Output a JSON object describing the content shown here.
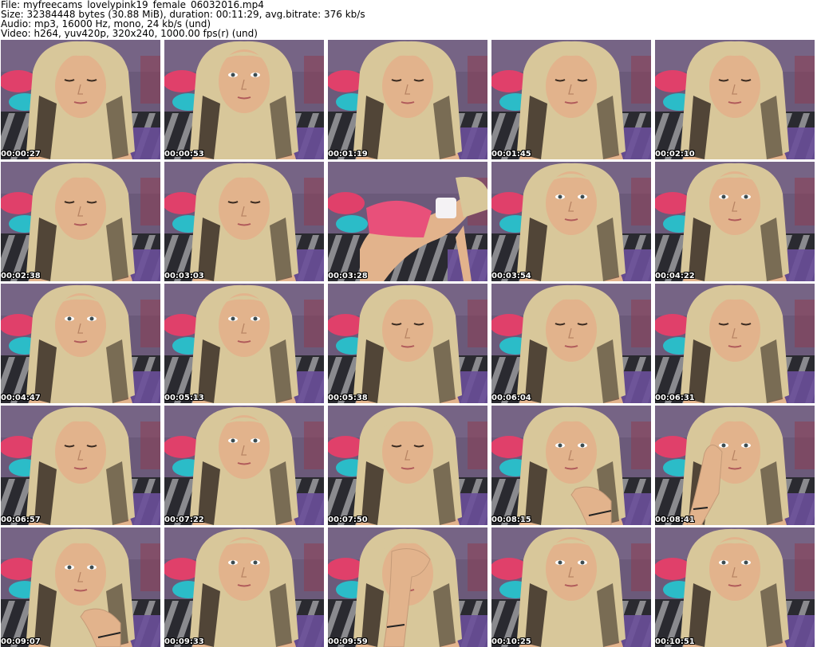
{
  "header": {
    "file_line": "File: myfreecams_lovelypink19_female_06032016.mp4",
    "size_line": "Size: 32384448 bytes (30.88 MiB), duration: 00:11:29, avg.bitrate: 376 kb/s",
    "audio_line": "Audio: mp3, 16000 Hz, mono, 24 kb/s (und)",
    "video_line": "Video: h264, yuv420p, 320x240, 1000.00 fps(r) (und)"
  },
  "thumbnails": [
    {
      "timestamp": "00:00:27",
      "pose": "face-down"
    },
    {
      "timestamp": "00:00:53",
      "pose": "face-up"
    },
    {
      "timestamp": "00:01:19",
      "pose": "face-down"
    },
    {
      "timestamp": "00:01:45",
      "pose": "face-down"
    },
    {
      "timestamp": "00:02:10",
      "pose": "face-down"
    },
    {
      "timestamp": "00:02:38",
      "pose": "face-down"
    },
    {
      "timestamp": "00:03:03",
      "pose": "face-down"
    },
    {
      "timestamp": "00:03:28",
      "pose": "bent-over"
    },
    {
      "timestamp": "00:03:54",
      "pose": "face-up"
    },
    {
      "timestamp": "00:04:22",
      "pose": "face-up"
    },
    {
      "timestamp": "00:04:47",
      "pose": "face-up"
    },
    {
      "timestamp": "00:05:13",
      "pose": "face-up"
    },
    {
      "timestamp": "00:05:38",
      "pose": "face-down"
    },
    {
      "timestamp": "00:06:04",
      "pose": "face-down"
    },
    {
      "timestamp": "00:06:31",
      "pose": "face-down"
    },
    {
      "timestamp": "00:06:57",
      "pose": "face-down"
    },
    {
      "timestamp": "00:07:22",
      "pose": "face-up"
    },
    {
      "timestamp": "00:07:50",
      "pose": "face-down"
    },
    {
      "timestamp": "00:08:15",
      "pose": "hand-chin"
    },
    {
      "timestamp": "00:08:41",
      "pose": "hand-cheek"
    },
    {
      "timestamp": "00:09:07",
      "pose": "hand-chin"
    },
    {
      "timestamp": "00:09:33",
      "pose": "face-up"
    },
    {
      "timestamp": "00:09:59",
      "pose": "hand-face"
    },
    {
      "timestamp": "00:10:25",
      "pose": "face-up"
    },
    {
      "timestamp": "00:10:51",
      "pose": "face-up"
    }
  ],
  "colors": {
    "wall": "#6b5a7a",
    "pillow_pink": "#e0406a",
    "pillow_teal": "#2bbcc8",
    "bedding_dark": "#2a2a30",
    "bedding_light": "#d8d8dc",
    "purple_blanket": "#6a4f9a",
    "hair_light": "#d8c79a",
    "hair_dark": "#3a2e26",
    "skin": "#e2b38c",
    "top_white": "#f4f2f4",
    "shorts_pink": "#e8507a",
    "timestamp_text": "#ffffff"
  }
}
